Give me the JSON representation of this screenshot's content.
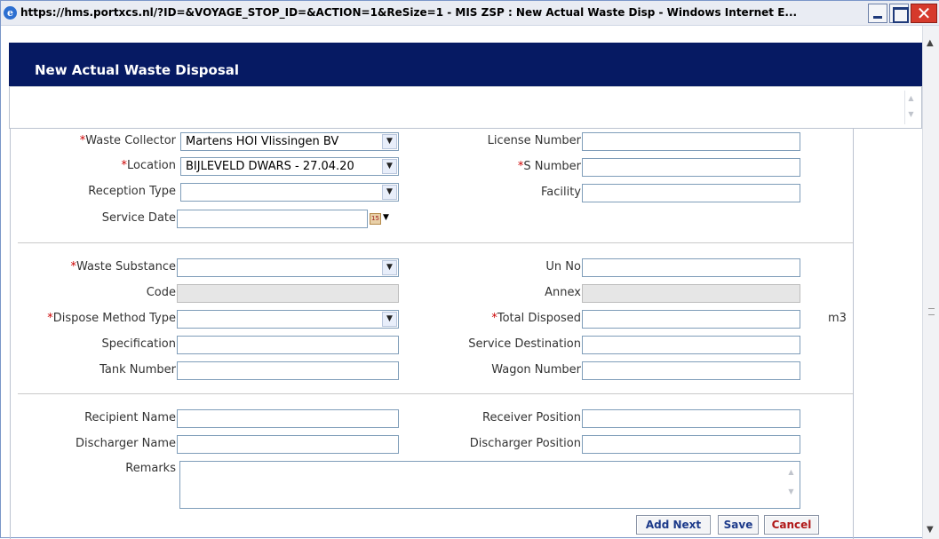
{
  "window": {
    "title": "https://hms.portxcs.nl/?ID=&VOYAGE_STOP_ID=&ACTION=1&ReSize=1 - MIS ZSP : New Actual Waste Disp - Windows Internet E..."
  },
  "header": {
    "title": "New Actual Waste Disposal"
  },
  "section1": {
    "waste_collector_label": "Waste Collector",
    "waste_collector_value": "Martens HOI Vlissingen BV",
    "location_label": "Location",
    "location_value": "BIJLEVELD DWARS - 27.04.20",
    "reception_type_label": "Reception Type",
    "reception_type_value": "",
    "service_date_label": "Service Date",
    "service_date_value": "",
    "license_number_label": "License Number",
    "s_number_label": "S Number",
    "facility_label": "Facility"
  },
  "section2": {
    "waste_substance_label": "Waste Substance",
    "code_label": "Code",
    "dispose_method_label": "Dispose Method Type",
    "specification_label": "Specification",
    "tank_number_label": "Tank Number",
    "un_no_label": "Un No",
    "annex_label": "Annex",
    "total_disposed_label": "Total Disposed",
    "total_disposed_unit": "m3",
    "service_destination_label": "Service Destination",
    "wagon_number_label": "Wagon Number"
  },
  "section3": {
    "recipient_name_label": "Recipient Name",
    "discharger_name_label": "Discharger Name",
    "remarks_label": "Remarks",
    "receiver_position_label": "Receiver Position",
    "discharger_position_label": "Discharger Position"
  },
  "buttons": {
    "add_next": "Add Next",
    "save": "Save",
    "cancel": "Cancel"
  },
  "colors": {
    "header_bg": "#061a63",
    "required_marker": "#cc0000"
  },
  "icons": [
    "ie-icon",
    "minimize-icon",
    "maximize-icon",
    "close-icon",
    "calendar-icon",
    "chevron-down-icon"
  ]
}
